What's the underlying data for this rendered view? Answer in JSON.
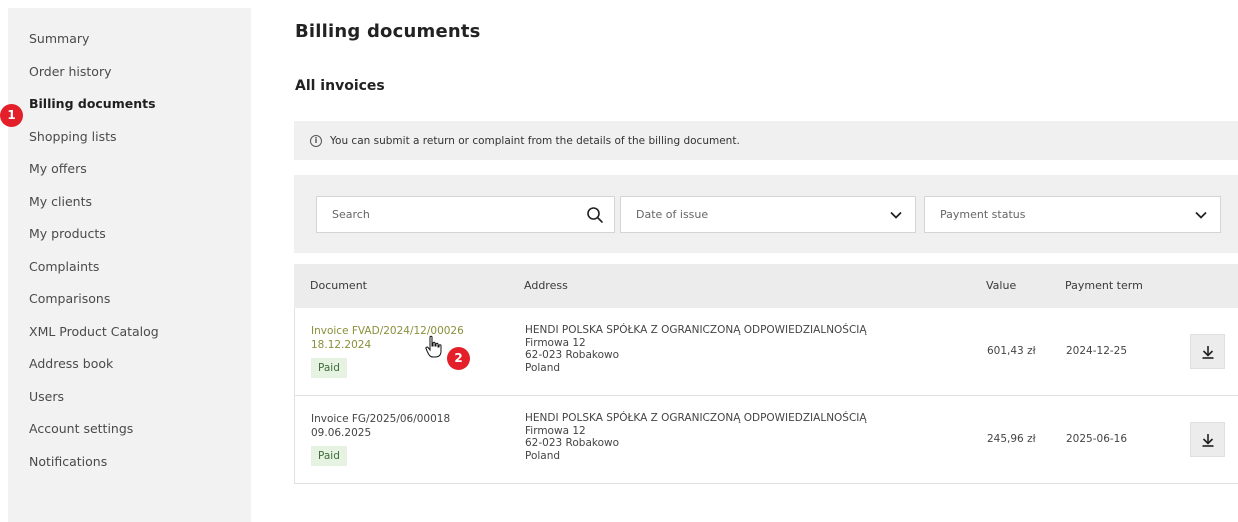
{
  "sidebar": {
    "items": [
      {
        "label": "Summary"
      },
      {
        "label": "Order history"
      },
      {
        "label": "Billing documents"
      },
      {
        "label": "Shopping lists"
      },
      {
        "label": "My offers"
      },
      {
        "label": "My clients"
      },
      {
        "label": "My products"
      },
      {
        "label": "Complaints"
      },
      {
        "label": "Comparisons"
      },
      {
        "label": "XML Product Catalog"
      },
      {
        "label": "Address book"
      },
      {
        "label": "Users"
      },
      {
        "label": "Account settings"
      },
      {
        "label": "Notifications"
      }
    ],
    "active_index": 2
  },
  "markers": {
    "one": "1",
    "two": "2"
  },
  "main": {
    "title": "Billing documents",
    "section_title": "All invoices",
    "info_text": "You can submit a return or complaint from the details of the billing document.",
    "info_icon": "i"
  },
  "filters": {
    "search_placeholder": "Search",
    "date_placeholder": "Date of issue",
    "payment_placeholder": "Payment status"
  },
  "table": {
    "headers": {
      "document": "Document",
      "address": "Address",
      "value": "Value",
      "term": "Payment term"
    },
    "rows": [
      {
        "doc": "Invoice FVAD/2024/12/00026",
        "date": "18.12.2024",
        "status": "Paid",
        "addr1": "HENDI POLSKA SPÓŁKA Z OGRANICZONĄ ODPOWIEDZIALNOŚCIĄ",
        "addr2": "Firmowa 12",
        "addr3": "62-023 Robakowo",
        "addr4": "Poland",
        "value": "601,43 zł",
        "term": "2024-12-25"
      },
      {
        "doc": "Invoice FG/2025/06/00018",
        "date": "09.06.2025",
        "status": "Paid",
        "addr1": "HENDI POLSKA SPÓŁKA Z OGRANICZONĄ ODPOWIEDZIALNOŚCIĄ",
        "addr2": "Firmowa 12",
        "addr3": "62-023 Robakowo",
        "addr4": "Poland",
        "value": "245,96 zł",
        "term": "2025-06-16"
      }
    ]
  },
  "colors": {
    "accent_link": "#8a8f3a",
    "marker_red": "#e3202a",
    "paid_bg": "#e6f3e3"
  },
  "icons": [
    "search-icon",
    "chevron-down-icon",
    "info-icon",
    "download-icon",
    "hand-cursor-icon"
  ]
}
